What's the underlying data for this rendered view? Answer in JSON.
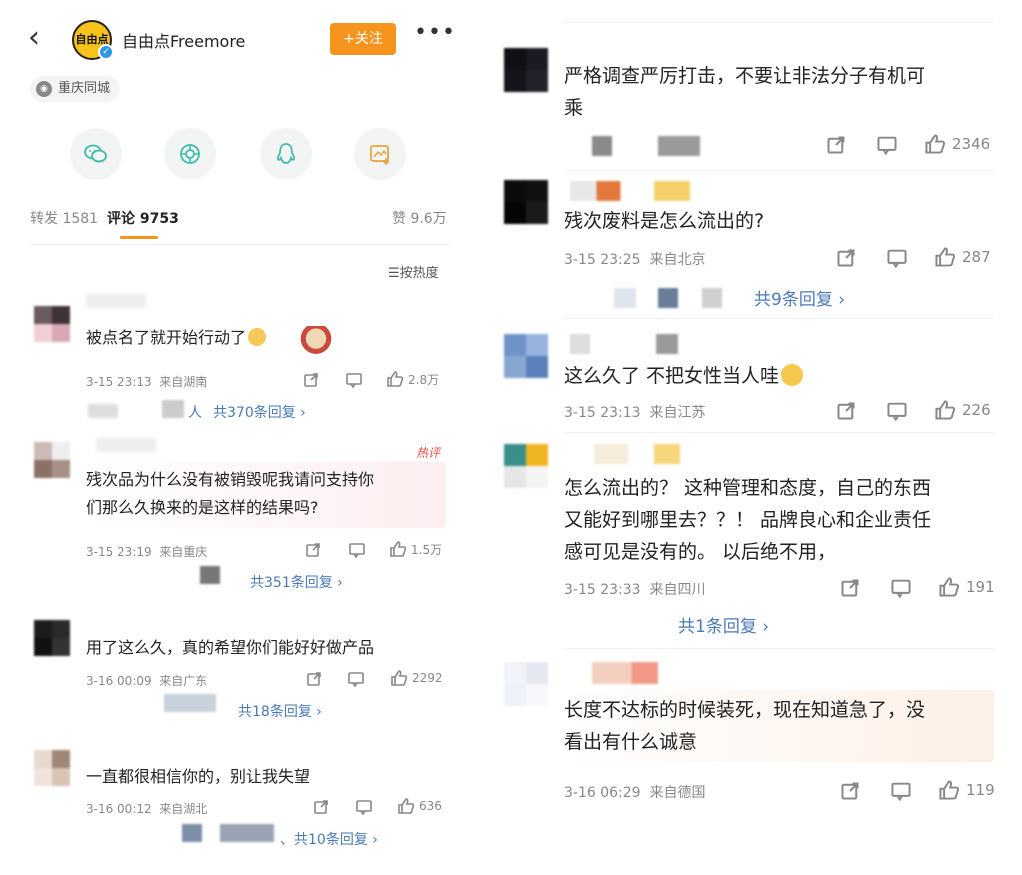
{
  "header": {
    "back": "‹",
    "account_name": "自由点Freemore",
    "avatar_text": "自由点",
    "follow_label": "+关注",
    "more": "•••",
    "location": "重庆同城"
  },
  "stats": {
    "repost": "转发 1581",
    "comments": "评论 9753",
    "likes": "赞 9.6万"
  },
  "sort_label": "☰按热度",
  "hot_label": "热评",
  "left_comments": [
    {
      "text": "被点名了就开始行动了",
      "time": "3-15 23:13",
      "from": "来自湖南",
      "likes": "2.8万",
      "replies": "共370条回复 ›",
      "reply_prefix": "人"
    },
    {
      "text_line1": "残次品为什么没有被销毁呢我请问支持你",
      "text_line2": "们那么久换来的是这样的结果吗?",
      "time": "3-15 23:19",
      "from": "来自重庆",
      "likes": "1.5万",
      "replies": "共351条回复 ›"
    },
    {
      "text": "用了这么久，真的希望你们能好好做产品",
      "time": "3-16 00:09",
      "from": "来自广东",
      "likes": "2292",
      "replies": "共18条回复 ›"
    },
    {
      "text": "一直都很相信你的，别让我失望",
      "time": "3-16 00:12",
      "from": "来自湖北",
      "likes": "636",
      "replies": "共10条回复 ›",
      "reply_prefix": "、"
    }
  ],
  "right_comments": [
    {
      "text_line1": "严格调查严厉打击，不要让非法分子有机可",
      "text_line2": "乘",
      "likes": "2346"
    },
    {
      "text": "残次废料是怎么流出的?",
      "time": "3-15 23:25",
      "from": "来自北京",
      "likes": "287",
      "replies": "共9条回复 ›"
    },
    {
      "text": "这么久了 不把女性当人哇",
      "time": "3-15 23:13",
      "from": "来自江苏",
      "likes": "226"
    },
    {
      "text_line1": "怎么流出的？ 这种管理和态度，自己的东西",
      "text_line2": "又能好到哪里去？？！ 品牌良心和企业责任",
      "text_line3": "感可见是没有的。 以后绝不用，",
      "time": "3-15 23:33",
      "from": "来自四川",
      "likes": "191",
      "replies": "共1条回复 ›"
    },
    {
      "text_line1": "长度不达标的时候装死，现在知道急了，没",
      "text_line2": "看出有什么诚意",
      "time": "3-16 06:29",
      "from": "来自德国",
      "likes": "119"
    }
  ],
  "colors": {
    "accent_orange": "#f7941d",
    "reply_blue": "#4a7ab8",
    "hot_red": "#e84c3d"
  },
  "icons": [
    "back-icon",
    "more-icon",
    "wechat-icon",
    "moments-icon",
    "qq-icon",
    "save-image-icon",
    "share-icon",
    "comment-icon",
    "like-icon"
  ]
}
